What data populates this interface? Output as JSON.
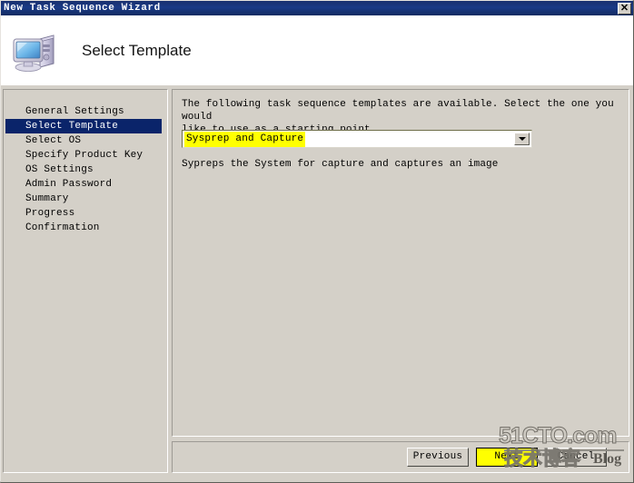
{
  "window": {
    "title": "New Task Sequence Wizard",
    "close_label": "✕",
    "close_icon": "close-icon"
  },
  "header": {
    "title": "Select Template",
    "icon": "computer-icon"
  },
  "sidebar": {
    "items": [
      {
        "label": "General Settings",
        "selected": false
      },
      {
        "label": "Select Template",
        "selected": true
      },
      {
        "label": "Select OS",
        "selected": false
      },
      {
        "label": "Specify Product Key",
        "selected": false
      },
      {
        "label": "OS Settings",
        "selected": false
      },
      {
        "label": "Admin Password",
        "selected": false
      },
      {
        "label": "Summary",
        "selected": false
      },
      {
        "label": "Progress",
        "selected": false
      },
      {
        "label": "Confirmation",
        "selected": false
      }
    ]
  },
  "main": {
    "intro_text": "The following task sequence templates are available.  Select the one you would\nlike to use as a starting point.",
    "combo": {
      "selected_value": "Sysprep and Capture",
      "arrow_icon": "chevron-down-icon",
      "options": [
        "Sysprep and Capture"
      ]
    },
    "description": "Sypreps the System for capture and captures an image"
  },
  "footer": {
    "previous_label": "Previous",
    "next_label": "Next",
    "cancel_label": "Cancel"
  },
  "watermark": {
    "top_text": "51CTO.com",
    "bottom_text": "技术博客",
    "blog_text": "Blog"
  },
  "colors": {
    "titlebar": "#1a3a86",
    "window_face": "#d4d0c8",
    "selection": "#0a246a",
    "highlight_yellow": "#ffff00",
    "header_background": "#ffffff"
  }
}
